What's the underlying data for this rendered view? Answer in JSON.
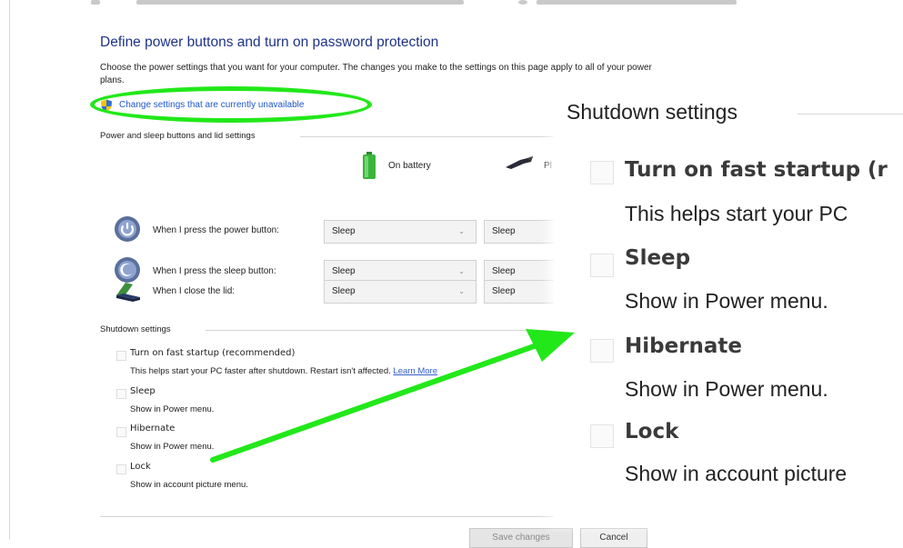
{
  "header": {
    "title": "Define power buttons and turn on password protection",
    "description": "Choose the power settings that you want for your computer. The changes you make to the settings on this page apply to all of your power plans.",
    "change_link": "Change settings that are currently unavailable"
  },
  "power_group": {
    "heading": "Power and sleep buttons and lid settings",
    "columns": {
      "battery": "On battery",
      "plugged": "Pl"
    },
    "rows": [
      {
        "label": "When I press the power button:",
        "battery_value": "Sleep",
        "plugged_value": "Sleep",
        "icon": "power-button-icon"
      },
      {
        "label": "When I press the sleep button:",
        "battery_value": "Sleep",
        "plugged_value": "Sleep",
        "icon": "sleep-button-icon"
      },
      {
        "label": "When I close the lid:",
        "battery_value": "Sleep",
        "plugged_value": "Sleep",
        "icon": "laptop-lid-icon"
      }
    ]
  },
  "shutdown": {
    "heading": "Shutdown settings",
    "options": [
      {
        "title": "Turn on fast startup (recommended)",
        "desc_prefix": "This helps start your PC faster after shutdown. Restart isn't affected.",
        "link": "Learn More"
      },
      {
        "title": "Sleep",
        "desc": "Show in Power menu."
      },
      {
        "title": "Hibernate",
        "desc": "Show in Power menu."
      },
      {
        "title": "Lock",
        "desc": "Show in account picture menu."
      }
    ]
  },
  "zoom": {
    "heading": "Shutdown settings",
    "options": [
      {
        "title": "Turn on fast startup (r",
        "desc": "This helps start your PC"
      },
      {
        "title": "Sleep",
        "desc": "Show in Power menu."
      },
      {
        "title": "Hibernate",
        "desc": "Show in Power menu."
      },
      {
        "title": "Lock",
        "desc": "Show in account picture"
      }
    ]
  },
  "buttons": {
    "save": "Save changes",
    "cancel": "Cancel"
  },
  "colors": {
    "link": "#1e57c8",
    "title": "#1e3287",
    "highlight": "#22e81a"
  }
}
